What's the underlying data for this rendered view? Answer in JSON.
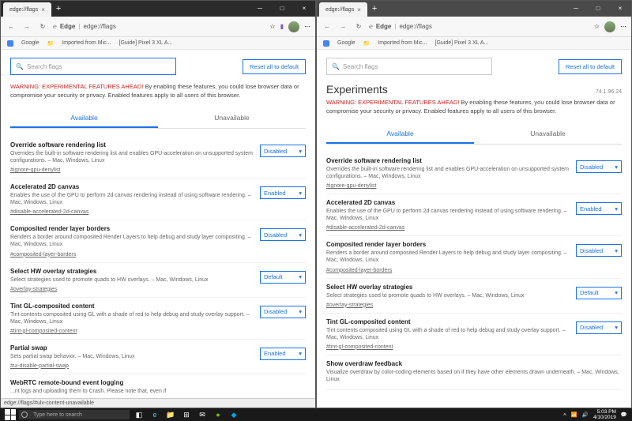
{
  "left": {
    "tab_title": "edge://flags",
    "addr_label": "Edge",
    "addr_url": "edge://flags",
    "bookmarks": [
      "Google",
      "Imported from Mic...",
      "[Guide] Pixel 3 XL A..."
    ],
    "search_placeholder": "Search flags",
    "reset_button": "Reset all to default",
    "warning_bold": "WARNING: EXPERIMENTAL FEATURES AHEAD!",
    "warning_text": " By enabling these features, you could lose browser data or compromise your security or privacy. Enabled features apply to all users of this browser.",
    "tab_available": "Available",
    "tab_unavailable": "Unavailable",
    "flags": [
      {
        "name": "Override software rendering list",
        "desc": "Overrides the built-in software rendering list and enables GPU-acceleration on unsupported system configurations. – Mac, Windows, Linux",
        "link": "#ignore-gpu-denylist",
        "value": "Disabled"
      },
      {
        "name": "Accelerated 2D canvas",
        "desc": "Enables the use of the GPU to perform 2d canvas rendering instead of using software rendering. – Mac, Windows, Linux",
        "link": "#disable-accelerated-2d-canvas",
        "value": "Enabled"
      },
      {
        "name": "Composited render layer borders",
        "desc": "Renders a border around composited Render Layers to help debug and study layer compositing. – Mac, Windows, Linux",
        "link": "#composited-layer-borders",
        "value": "Disabled"
      },
      {
        "name": "Select HW overlay strategies",
        "desc": "Select strategies used to promote quads to HW overlays. – Mac, Windows, Linux",
        "link": "#overlay-strategies",
        "value": "Default"
      },
      {
        "name": "Tint GL-composited content",
        "desc": "Tint contents composited using GL with a shade of red to help debug and study overlay support. – Mac, Windows, Linux",
        "link": "#tint-gl-composited-content",
        "value": "Disabled"
      },
      {
        "name": "Partial swap",
        "desc": "Sets partial swap behavior. – Mac, Windows, Linux",
        "link": "#ui-disable-partial-swap",
        "value": "Enabled"
      },
      {
        "name": "WebRTC remote-bound event logging",
        "desc": "...nt logs and uploading them to Crash. Please note that, even if",
        "link": "",
        "value": ""
      }
    ],
    "status_url": "edge://flags/#ulv-content-unavailable"
  },
  "right": {
    "tab_title": "edge://flags",
    "addr_label": "Edge",
    "addr_url": "edge://flags",
    "bookmarks": [
      "Google",
      "Imported from Mic...",
      "[Guide] Pixel 3 XL A..."
    ],
    "search_placeholder": "Search flags",
    "reset_button": "Reset all to default",
    "heading": "Experiments",
    "version": "74.1.96.24",
    "warning_bold": "WARNING: EXPERIMENTAL FEATURES AHEAD!",
    "warning_text": " By enabling these features, you could lose browser data or compromise your security or privacy. Enabled features apply to all users of this browser.",
    "tab_available": "Available",
    "tab_unavailable": "Unavailable",
    "flags": [
      {
        "name": "Override software rendering list",
        "desc": "Overrides the built-in software rendering list and enables GPU-acceleration on unsupported system configurations. – Mac, Windows, Linux",
        "link": "#ignore-gpu-denylist",
        "value": "Disabled"
      },
      {
        "name": "Accelerated 2D canvas",
        "desc": "Enables the use of the GPU to perform 2d canvas rendering instead of using software rendering. – Mac, Windows, Linux",
        "link": "#disable-accelerated-2d-canvas",
        "value": "Enabled"
      },
      {
        "name": "Composited render layer borders",
        "desc": "Renders a border around composited Render Layers to help debug and study layer compositing. – Mac, Windows, Linux",
        "link": "#composited-layer-borders",
        "value": "Disabled"
      },
      {
        "name": "Select HW overlay strategies",
        "desc": "Select strategies used to promote quads to HW overlays. – Mac, Windows, Linux",
        "link": "#overlay-strategies",
        "value": "Default"
      },
      {
        "name": "Tint GL-composited content",
        "desc": "Tint contents composited using GL with a shade of red to help debug and study overlay support. – Mac, Windows, Linux",
        "link": "#tint-gl-composited-content",
        "value": "Disabled"
      },
      {
        "name": "Show overdraw feedback",
        "desc": "Visualize overdraw by color-coding elements based on if they have other elements drawn underneath. – Mac, Windows, Linux",
        "link": "",
        "value": ""
      }
    ]
  },
  "taskbar": {
    "search_placeholder": "Type here to search",
    "time": "5:03 PM",
    "date": "4/10/2019"
  }
}
